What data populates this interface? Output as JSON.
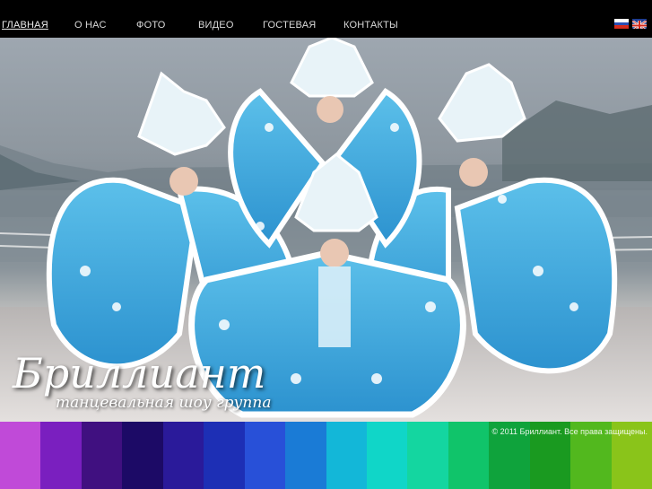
{
  "nav": {
    "items": [
      {
        "label": "ГЛАВНАЯ",
        "active": true
      },
      {
        "label": "О НАС",
        "active": false
      },
      {
        "label": "ФОТО",
        "active": false
      },
      {
        "label": "ВИДЕО",
        "active": false
      },
      {
        "label": "ГОСТЕВАЯ",
        "active": false
      },
      {
        "label": "КОНТАКТЫ",
        "active": false
      }
    ]
  },
  "languages": [
    "ru",
    "en"
  ],
  "hero": {
    "title": "Бриллиант",
    "subtitle": "танцевальная шоу группа"
  },
  "colors": {
    "topbar": "#000000",
    "nav_text": "#d9d9d9",
    "costume_blue": "#3aa9dc",
    "costume_light": "#bfe6f7",
    "colorbar": [
      "#c04ad8",
      "#7a1fbf",
      "#401080",
      "#1c0a66",
      "#2a1a9a",
      "#1d2fb5",
      "#2850d8",
      "#1a7bd6",
      "#13b7d8",
      "#10d6c8",
      "#14d6a0",
      "#10c46a",
      "#0fa33c",
      "#1a9a20",
      "#52b81e",
      "#8ac41a"
    ]
  },
  "footer": {
    "copyright": "© 2011 Бриллиант. Все права защищены."
  }
}
